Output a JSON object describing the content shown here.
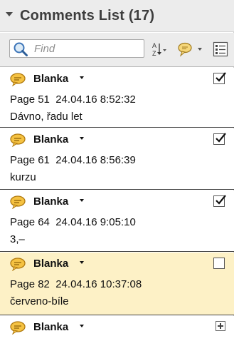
{
  "header": {
    "title": "Comments List (17)"
  },
  "toolbar": {
    "search_placeholder": "Find",
    "search_icon": "magnifier-icon",
    "sort_icon": "sort-az-icon",
    "filter_icon": "comment-filter-icon",
    "options_icon": "list-options-icon"
  },
  "comments": [
    {
      "author": "Blanka",
      "meta": "Page 51  24.04.16 8:52:32",
      "text": "Dávno, řadu let",
      "checked": true,
      "selected": false
    },
    {
      "author": "Blanka",
      "meta": "Page 61  24.04.16 8:56:39",
      "text": "kurzu",
      "checked": true,
      "selected": false
    },
    {
      "author": "Blanka",
      "meta": "Page 64  24.04.16 9:05:10",
      "text": "3,–",
      "checked": true,
      "selected": false
    },
    {
      "author": "Blanka",
      "meta": "Page 82  24.04.16 10:37:08",
      "text": "červeno-bíle",
      "checked": false,
      "selected": true
    },
    {
      "author": "Blanka",
      "meta": "",
      "text": "",
      "checked": false,
      "selected": false,
      "expand": true
    }
  ],
  "colors": {
    "selected_row": "#fdf1c6",
    "bubble_fill": "#f5c242",
    "bubble_stroke": "#b07a10"
  }
}
